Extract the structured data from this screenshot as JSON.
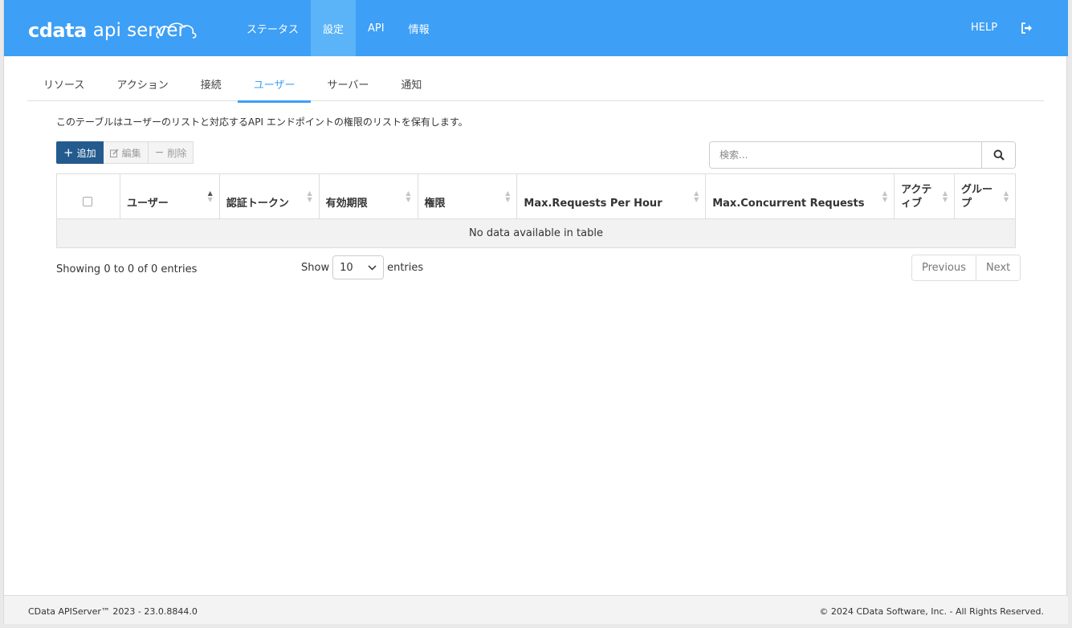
{
  "header": {
    "logo_brand": "cdata",
    "logo_product": "api server",
    "nav": [
      {
        "label": "ステータス",
        "active": false
      },
      {
        "label": "設定",
        "active": true
      },
      {
        "label": "API",
        "active": false
      },
      {
        "label": "情報",
        "active": false
      }
    ],
    "help_label": "HELP",
    "accent_color": "#3d9ff5"
  },
  "tabs": [
    {
      "label": "リソース",
      "active": false
    },
    {
      "label": "アクション",
      "active": false
    },
    {
      "label": "接続",
      "active": false
    },
    {
      "label": "ユーザー",
      "active": true
    },
    {
      "label": "サーバー",
      "active": false
    },
    {
      "label": "通知",
      "active": false
    }
  ],
  "description": "このテーブルはユーザーのリストと対応するAPI エンドポイントの権限のリストを保有します。",
  "toolbar": {
    "add_label": "追加",
    "edit_label": "編集",
    "delete_label": "削除"
  },
  "search": {
    "placeholder": "検索..."
  },
  "table": {
    "columns": [
      "ユーザー",
      "認証トークン",
      "有効期限",
      "権限",
      "Max.Requests Per Hour",
      "Max.Concurrent Requests",
      "アクティブ",
      "グループ"
    ],
    "empty_message": "No data available in table"
  },
  "pagination": {
    "info": "Showing 0 to 0 of 0 entries",
    "show_label": "Show",
    "page_size": "10",
    "entries_label": "entries",
    "previous_label": "Previous",
    "next_label": "Next"
  },
  "footer": {
    "version": "CData APIServer™ 2023 - 23.0.8844.0",
    "copyright": "© 2024 CData Software, Inc. - All Rights Reserved."
  }
}
